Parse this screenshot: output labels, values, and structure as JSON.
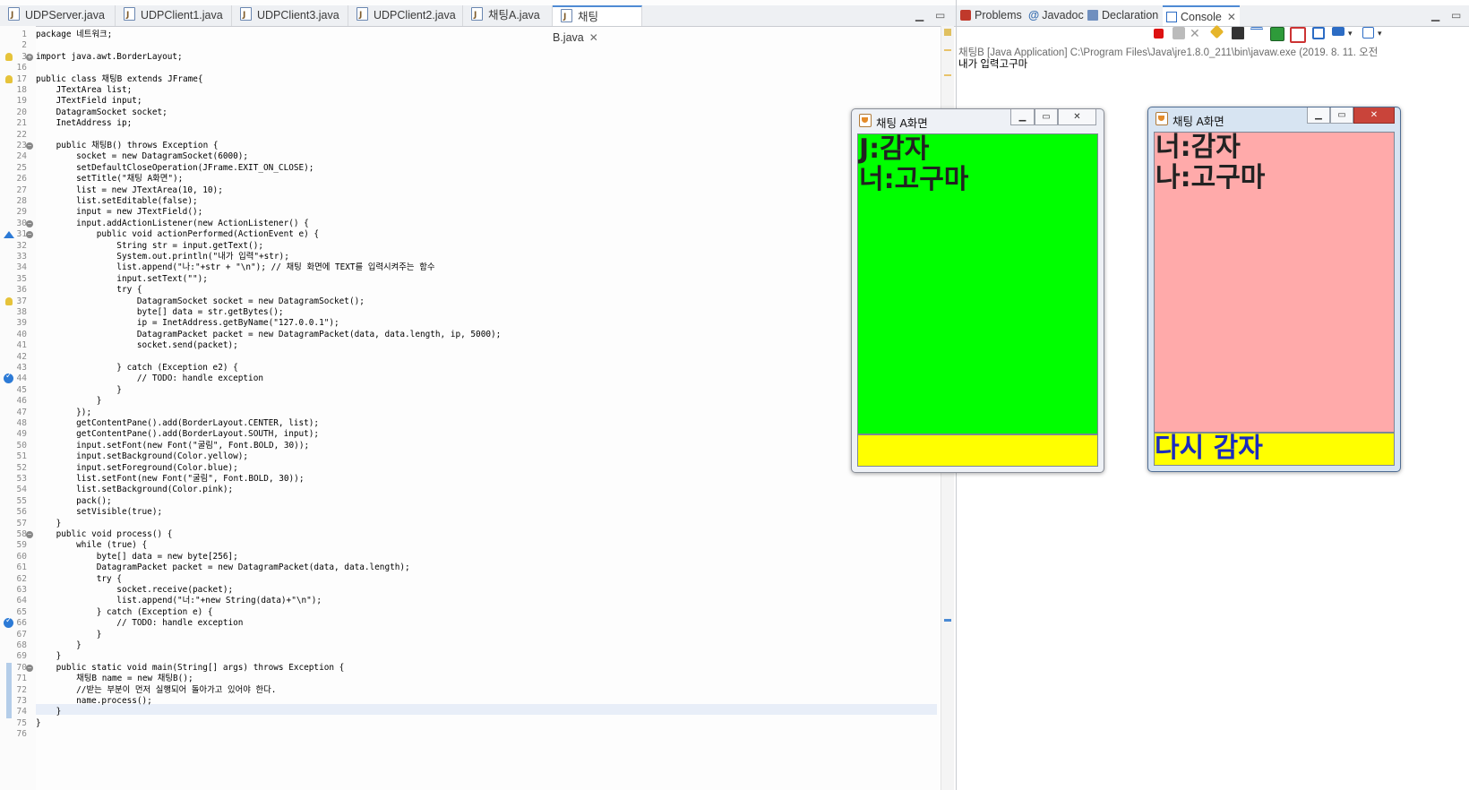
{
  "editor": {
    "tabs": [
      {
        "label": "UDPServer.java"
      },
      {
        "label": "UDPClient1.java"
      },
      {
        "label": "UDPClient3.java"
      },
      {
        "label": "UDPClient2.java"
      },
      {
        "label": "채팅A.java"
      },
      {
        "label": "채팅B.java"
      }
    ],
    "line_numbers": [
      "1",
      "2",
      "3",
      "16",
      "17",
      "18",
      "19",
      "20",
      "21",
      "22",
      "23",
      "24",
      "25",
      "26",
      "27",
      "28",
      "29",
      "30",
      "31",
      "32",
      "33",
      "34",
      "35",
      "36",
      "37",
      "38",
      "39",
      "40",
      "41",
      "42",
      "43",
      "44",
      "45",
      "46",
      "47",
      "48",
      "49",
      "50",
      "51",
      "52",
      "53",
      "54",
      "55",
      "56",
      "57",
      "58",
      "59",
      "60",
      "61",
      "62",
      "63",
      "64",
      "65",
      "66",
      "67",
      "68",
      "69",
      "70",
      "71",
      "72",
      "73",
      "74",
      "75",
      "76"
    ],
    "code_lines": [
      "package 네트워크;",
      "",
      "import java.awt.BorderLayout;",
      "",
      "public class 채팅B extends JFrame{",
      "    JTextArea list;",
      "    JTextField input;",
      "    DatagramSocket socket;",
      "    InetAddress ip;",
      "",
      "    public 채팅B() throws Exception {",
      "        socket = new DatagramSocket(6000);",
      "        setDefaultCloseOperation(JFrame.EXIT_ON_CLOSE);",
      "        setTitle(\"채팅 A화면\");",
      "        list = new JTextArea(10, 10);",
      "        list.setEditable(false);",
      "        input = new JTextField();",
      "        input.addActionListener(new ActionListener() {",
      "            public void actionPerformed(ActionEvent e) {",
      "                String str = input.getText();",
      "                System.out.println(\"내가 입력\"+str);",
      "                list.append(\"나:\"+str + \"\\n\"); // 채팅 화면에 TEXT를 입력시켜주는 함수",
      "                input.setText(\"\");",
      "                try {",
      "                    DatagramSocket socket = new DatagramSocket();",
      "                    byte[] data = str.getBytes();",
      "                    ip = InetAddress.getByName(\"127.0.0.1\");",
      "                    DatagramPacket packet = new DatagramPacket(data, data.length, ip, 5000);",
      "                    socket.send(packet);",
      "",
      "                } catch (Exception e2) {",
      "                    // TODO: handle exception",
      "                }",
      "            }",
      "        });",
      "        getContentPane().add(BorderLayout.CENTER, list);",
      "        getContentPane().add(BorderLayout.SOUTH, input);",
      "        input.setFont(new Font(\"굴림\", Font.BOLD, 30));",
      "        input.setBackground(Color.yellow);",
      "        input.setForeground(Color.blue);",
      "        list.setFont(new Font(\"굴림\", Font.BOLD, 30));",
      "        list.setBackground(Color.pink);",
      "        pack();",
      "        setVisible(true);",
      "    }",
      "    public void process() {",
      "        while (true) {",
      "            byte[] data = new byte[256];",
      "            DatagramPacket packet = new DatagramPacket(data, data.length);",
      "            try {",
      "                socket.receive(packet);",
      "                list.append(\"너:\"+new String(data)+\"\\n\");",
      "            } catch (Exception e) {",
      "                // TODO: handle exception",
      "            }",
      "        }",
      "    }",
      "    public static void main(String[] args) throws Exception {",
      "        채팅B name = new 채팅B();",
      "        //받는 부분이 먼저 실행되어 돌아가고 있어야 한다.",
      "        name.process();",
      "    }",
      "}",
      ""
    ]
  },
  "console": {
    "tabs": [
      {
        "label": "Problems",
        "icon": "problems-icon"
      },
      {
        "label": "Javadoc",
        "icon": "at-icon"
      },
      {
        "label": "Declaration",
        "icon": "declaration-icon"
      },
      {
        "label": "Console",
        "icon": "console-icon"
      }
    ],
    "launch_path": "채팅B [Java Application] C:\\Program Files\\Java\\jre1.8.0_211\\bin\\javaw.exe (2019. 8. 11. 오전",
    "output": "내가 입력고구마"
  },
  "window_a": {
    "title": "채팅 A화면",
    "messages": [
      "J:감자",
      "너:고구마"
    ],
    "input_value": "",
    "area_color": "#00ff00",
    "input_color": "#ffff00"
  },
  "window_b": {
    "title": "채팅 A화면",
    "messages": [
      "너:감자",
      "나:고구마"
    ],
    "input_value": "다시 감자",
    "area_color": "#ffaaaa",
    "input_color": "#ffff00"
  }
}
